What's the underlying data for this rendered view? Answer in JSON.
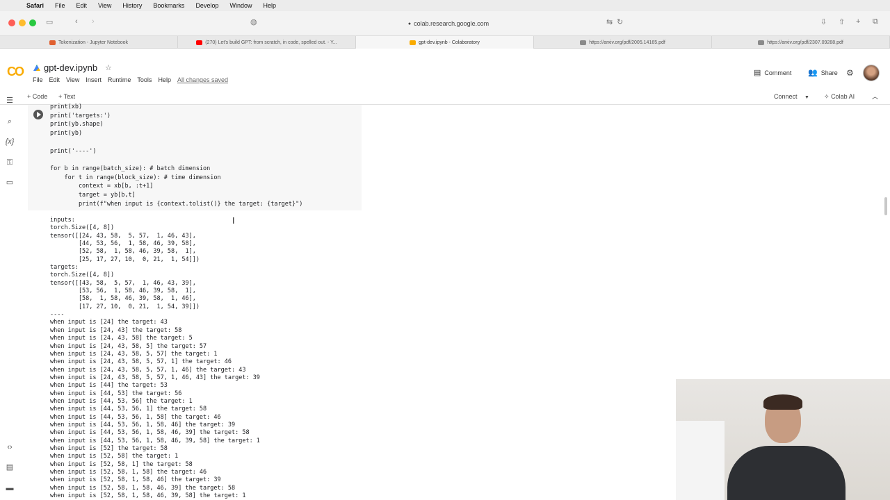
{
  "mac_menu": [
    "Safari",
    "File",
    "Edit",
    "View",
    "History",
    "Bookmarks",
    "Develop",
    "Window",
    "Help"
  ],
  "url": "colab.research.google.com",
  "tabs": [
    {
      "label": "Tokenization - Jupyter Notebook",
      "color": "#e06030"
    },
    {
      "label": "(270) Let's build GPT: from scratch, in code, spelled out. - Y...",
      "color": "#ff0000"
    },
    {
      "label": "gpt-dev.ipynb - Colaboratory",
      "color": "#f9ab00"
    },
    {
      "label": "https://arxiv.org/pdf/2005.14165.pdf",
      "color": "#8a8a8a"
    },
    {
      "label": "https://arxiv.org/pdf/2307.09288.pdf",
      "color": "#8a8a8a"
    }
  ],
  "colab": {
    "logo": "CO",
    "title": "gpt-dev.ipynb",
    "menus": [
      "File",
      "Edit",
      "View",
      "Insert",
      "Runtime",
      "Tools",
      "Help"
    ],
    "saved_status": "All changes saved",
    "comment": "Comment",
    "share": "Share"
  },
  "toolbar": {
    "add_code": "+ Code",
    "add_text": "+ Text",
    "connect": "Connect",
    "colab_ai": "Colab AI"
  },
  "code_cell": {
    "code": "print(xb)\nprint('targets:')\nprint(yb.shape)\nprint(yb)\n\nprint('----')\n\nfor b in range(batch_size): # batch dimension\n    for t in range(block_size): # time dimension\n        context = xb[b, :t+1]\n        target = yb[b,t]\n        print(f\"when input is {context.tolist()} the target: {target}\")",
    "output": "inputs:\ntorch.Size([4, 8])\ntensor([[24, 43, 58,  5, 57,  1, 46, 43],\n        [44, 53, 56,  1, 58, 46, 39, 58],\n        [52, 58,  1, 58, 46, 39, 58,  1],\n        [25, 17, 27, 10,  0, 21,  1, 54]])\ntargets:\ntorch.Size([4, 8])\ntensor([[43, 58,  5, 57,  1, 46, 43, 39],\n        [53, 56,  1, 58, 46, 39, 58,  1],\n        [58,  1, 58, 46, 39, 58,  1, 46],\n        [17, 27, 10,  0, 21,  1, 54, 39]])\n----\nwhen input is [24] the target: 43\nwhen input is [24, 43] the target: 58\nwhen input is [24, 43, 58] the target: 5\nwhen input is [24, 43, 58, 5] the target: 57\nwhen input is [24, 43, 58, 5, 57] the target: 1\nwhen input is [24, 43, 58, 5, 57, 1] the target: 46\nwhen input is [24, 43, 58, 5, 57, 1, 46] the target: 43\nwhen input is [24, 43, 58, 5, 57, 1, 46, 43] the target: 39\nwhen input is [44] the target: 53\nwhen input is [44, 53] the target: 56\nwhen input is [44, 53, 56] the target: 1\nwhen input is [44, 53, 56, 1] the target: 58\nwhen input is [44, 53, 56, 1, 58] the target: 46\nwhen input is [44, 53, 56, 1, 58, 46] the target: 39\nwhen input is [44, 53, 56, 1, 58, 46, 39] the target: 58\nwhen input is [44, 53, 56, 1, 58, 46, 39, 58] the target: 1\nwhen input is [52] the target: 58\nwhen input is [52, 58] the target: 1\nwhen input is [52, 58, 1] the target: 58\nwhen input is [52, 58, 1, 58] the target: 46\nwhen input is [52, 58, 1, 58, 46] the target: 39\nwhen input is [52, 58, 1, 58, 46, 39] the target: 58\nwhen input is [52, 58, 1, 58, 46, 39, 58] the target: 1"
  },
  "icons": {
    "rail": [
      "menu-icon",
      "search-icon",
      "variables-icon",
      "key-icon",
      "folder-icon",
      "code-snippets-icon",
      "command-palette-icon",
      "terminal-icon"
    ]
  }
}
